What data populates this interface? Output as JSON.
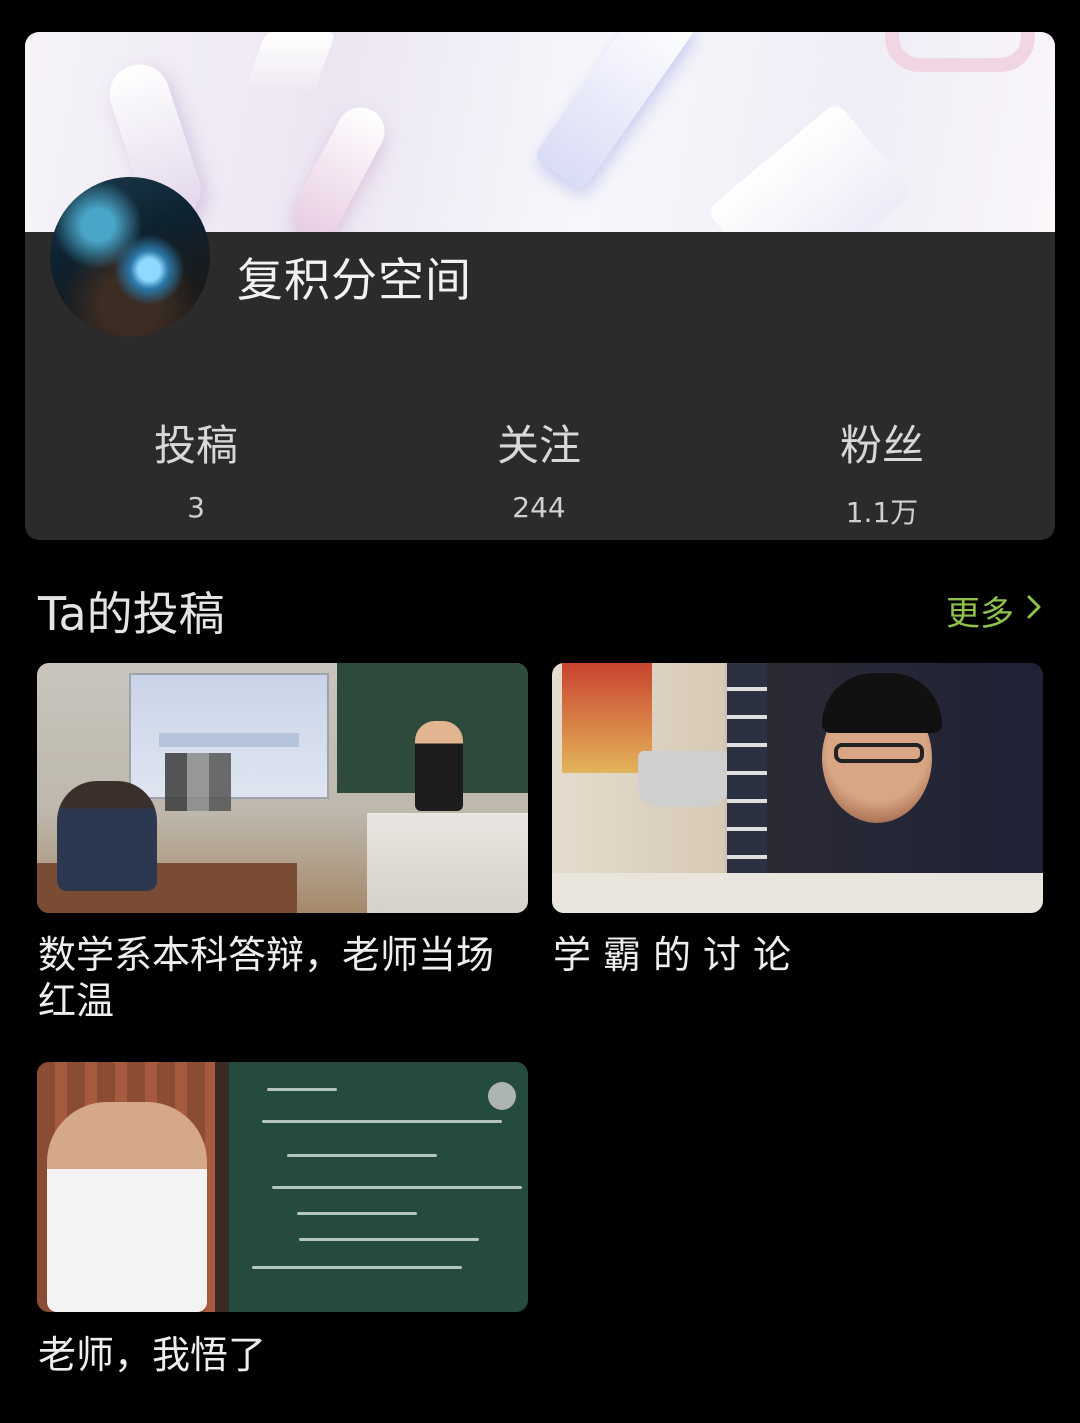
{
  "profile": {
    "username": "复积分空间",
    "stats": [
      {
        "label": "投稿",
        "value": "3"
      },
      {
        "label": "关注",
        "value": "244"
      },
      {
        "label": "粉丝",
        "value": "1.1万"
      }
    ]
  },
  "uploads": {
    "section_title": "Ta的投稿",
    "more_label": "更多",
    "more_icon": "chevron-right-icon",
    "videos": [
      {
        "title": "数学系本科答辩，老师当场红温"
      },
      {
        "title": "学霸的讨论"
      },
      {
        "title": "老师，我悟了"
      }
    ]
  },
  "colors": {
    "accent_green": "#8fc24a",
    "card_bg": "#2b2b2b",
    "page_bg": "#000000"
  }
}
